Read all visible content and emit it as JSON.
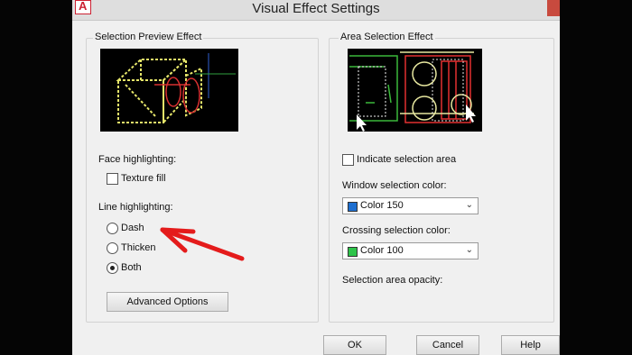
{
  "window": {
    "title": "Visual Effect Settings"
  },
  "selection_preview": {
    "title": "Selection Preview Effect",
    "face_label": "Face highlighting:",
    "texture_fill": "Texture fill",
    "line_label": "Line highlighting:",
    "dash": "Dash",
    "thicken": "Thicken",
    "both": "Both",
    "selected_line_option": "Both",
    "advanced_button": "Advanced Options"
  },
  "area_selection": {
    "title": "Area Selection Effect",
    "indicate": "Indicate selection area",
    "indicate_checked": false,
    "window_label": "Window selection color:",
    "window_value": "Color 150",
    "window_color": "#1e6fd0",
    "crossing_label": "Crossing selection color:",
    "crossing_value": "Color 100",
    "crossing_color": "#2ec44a",
    "opacity_label": "Selection area opacity:"
  },
  "footer": {
    "ok": "OK",
    "cancel": "Cancel",
    "help": "Help"
  },
  "annotation": {
    "arrow_color": "#e41b1b"
  }
}
